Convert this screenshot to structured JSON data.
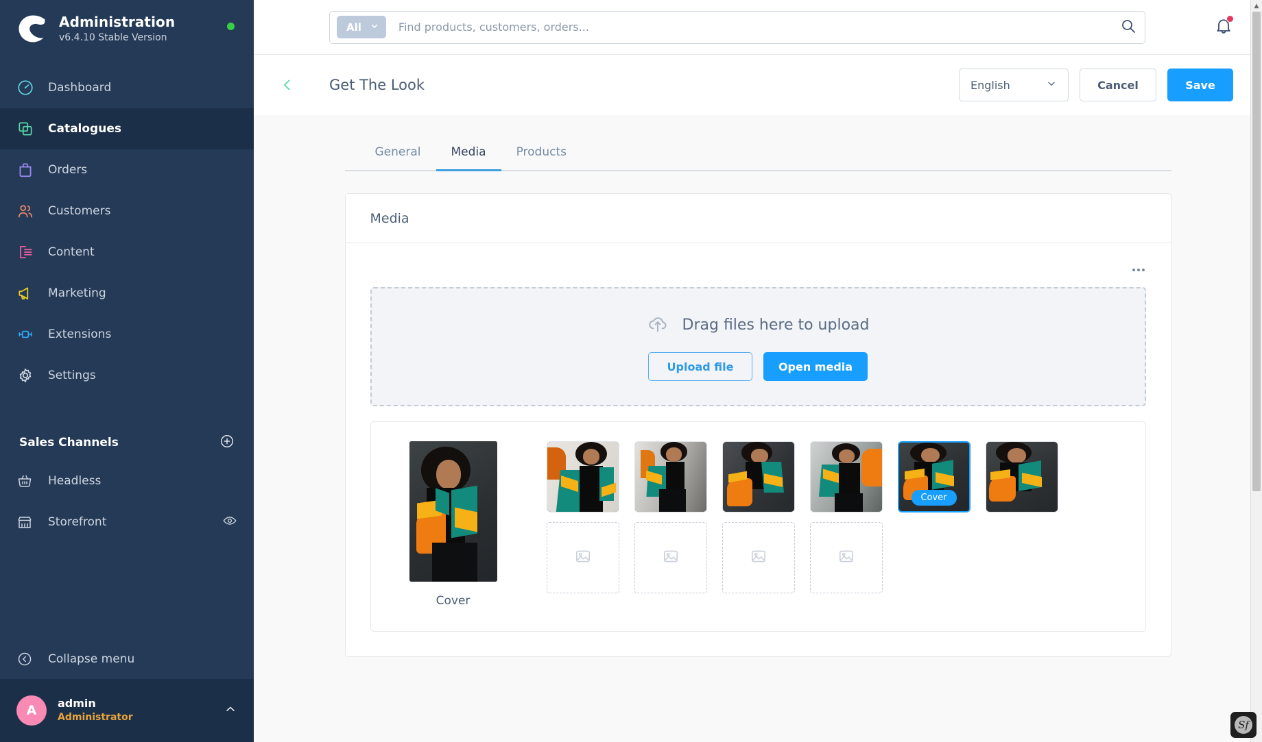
{
  "sidebar": {
    "brand": {
      "title": "Administration",
      "version": "v6.4.10 Stable Version",
      "status_icon": "green-status-dot",
      "logo_icon": "shopware-logo-icon"
    },
    "items": [
      {
        "label": "Dashboard",
        "icon": "dashboard-icon",
        "color": "#5fd1e0",
        "active": false
      },
      {
        "label": "Catalogues",
        "icon": "catalogues-icon",
        "color": "#5ad8a6",
        "active": true
      },
      {
        "label": "Orders",
        "icon": "orders-icon",
        "color": "#9b8cf5",
        "active": false
      },
      {
        "label": "Customers",
        "icon": "customers-icon",
        "color": "#f08a6a",
        "active": false
      },
      {
        "label": "Content",
        "icon": "content-icon",
        "color": "#ef5ba1",
        "active": false
      },
      {
        "label": "Marketing",
        "icon": "marketing-icon",
        "color": "#f2d024",
        "active": false
      },
      {
        "label": "Extensions",
        "icon": "extensions-icon",
        "color": "#2eaaf5",
        "active": false
      },
      {
        "label": "Settings",
        "icon": "settings-gear-icon",
        "color": "#cdd5e0",
        "active": false
      }
    ],
    "sales_channels": {
      "title": "Sales Channels",
      "add_icon": "plus-circle-icon",
      "items": [
        {
          "label": "Headless",
          "icon": "basket-icon",
          "trailing_icon": ""
        },
        {
          "label": "Storefront",
          "icon": "storefront-icon",
          "trailing_icon": "eye-icon"
        }
      ]
    },
    "collapse": {
      "label": "Collapse menu",
      "icon": "collapse-chevron-icon"
    },
    "user": {
      "initial": "A",
      "name": "admin",
      "role": "Administrator",
      "caret_icon": "chevron-up-icon",
      "avatar_color": "#f88ab3"
    }
  },
  "topbar": {
    "search": {
      "scope_label": "All",
      "scope_caret_icon": "chevron-down-icon",
      "placeholder": "Find products, customers, orders...",
      "value": "",
      "search_icon": "search-icon"
    },
    "notifications": {
      "icon": "bell-icon",
      "has_unread": true,
      "dot_color": "#e5375d"
    }
  },
  "pagehead": {
    "back_icon": "chevron-left-icon",
    "title": "Get The Look",
    "language": {
      "value": "English",
      "caret_icon": "chevron-down-icon"
    },
    "cancel_label": "Cancel",
    "save_label": "Save",
    "accent_color": "#74d9ae",
    "save_color": "#189eff"
  },
  "tabs": [
    {
      "label": "General",
      "active": false
    },
    {
      "label": "Media",
      "active": true
    },
    {
      "label": "Products",
      "active": false
    }
  ],
  "media_card": {
    "title": "Media",
    "context_menu_icon": "ellipsis-icon",
    "dropzone": {
      "icon": "cloud-upload-icon",
      "text": "Drag files here to upload",
      "upload_label": "Upload file",
      "open_media_label": "Open media"
    },
    "cover": {
      "caption": "Cover",
      "alt": "woman-in-teal-orange-jacket"
    },
    "thumbnails": [
      {
        "alt": "model-arm-raised-grid-wall",
        "selected": false,
        "badge": ""
      },
      {
        "alt": "model-side-alley",
        "selected": false,
        "badge": ""
      },
      {
        "alt": "model-looking-down",
        "selected": false,
        "badge": ""
      },
      {
        "alt": "model-hand-on-head",
        "selected": false,
        "badge": ""
      },
      {
        "alt": "model-crouching-cover",
        "selected": true,
        "badge": "Cover"
      },
      {
        "alt": "model-crouching-wall",
        "selected": false,
        "badge": ""
      }
    ],
    "placeholders": [
      {
        "icon": "image-placeholder-icon"
      },
      {
        "icon": "image-placeholder-icon"
      },
      {
        "icon": "image-placeholder-icon"
      },
      {
        "icon": "image-placeholder-icon"
      }
    ]
  },
  "scrollbar": {
    "up_arrow_icon": "scroll-up-arrow-icon"
  },
  "debug_toolbar": {
    "icon": "symfony-profiler-icon",
    "glyph": "Sf"
  }
}
